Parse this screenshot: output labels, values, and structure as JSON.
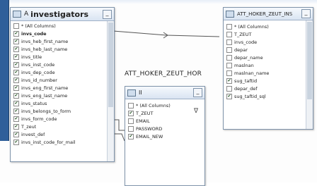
{
  "colors": {
    "accent": "#2f5f9a",
    "border": "#7f93aa",
    "title_bg": "#d9e4f2"
  },
  "tables": {
    "investigators": {
      "title_prefix": "A",
      "title": "investigators",
      "icon": "table-icon",
      "minimize": "_",
      "columns": [
        {
          "label": "* (All Columns)",
          "checked": false,
          "bold": false
        },
        {
          "label": "invs_code",
          "checked": true,
          "bold": true
        },
        {
          "label": "invs_heb_first_name",
          "checked": true,
          "bold": false
        },
        {
          "label": "invs_heb_last_name",
          "checked": true,
          "bold": false
        },
        {
          "label": "invs_title",
          "checked": true,
          "bold": false
        },
        {
          "label": "invs_inst_code",
          "checked": true,
          "bold": false
        },
        {
          "label": "invs_dep_code",
          "checked": true,
          "bold": false
        },
        {
          "label": "invs_id_number",
          "checked": true,
          "bold": false
        },
        {
          "label": "invs_eng_first_name",
          "checked": true,
          "bold": false
        },
        {
          "label": "invs_eng_last_name",
          "checked": true,
          "bold": false
        },
        {
          "label": "invs_status",
          "checked": true,
          "bold": false
        },
        {
          "label": "invs_belongs_to_form",
          "checked": true,
          "bold": false
        },
        {
          "label": "invs_form_code",
          "checked": true,
          "bold": false
        },
        {
          "label": "T_zeut",
          "checked": true,
          "bold": false
        },
        {
          "label": "invest_def",
          "checked": true,
          "bold": false
        },
        {
          "label": "invs_inst_code_for_mail",
          "checked": true,
          "bold": false
        }
      ]
    },
    "att_hoker_ins": {
      "title": "ATT_HOKER_ZEUT_INS",
      "icon": "table-icon",
      "minimize": "_",
      "columns": [
        {
          "label": "* (All Columns)",
          "checked": false
        },
        {
          "label": "T_ZEUT",
          "checked": false
        },
        {
          "label": "invs_code",
          "checked": false
        },
        {
          "label": "depar",
          "checked": false
        },
        {
          "label": "depar_name",
          "checked": false
        },
        {
          "label": "maslnan",
          "checked": false
        },
        {
          "label": "maslnan_name",
          "checked": false
        },
        {
          "label": "sug_taftid",
          "checked": true
        },
        {
          "label": "depar_def",
          "checked": false
        },
        {
          "label": "sug_taftid_sql",
          "checked": true
        }
      ]
    },
    "att_hoker_hor": {
      "caption": "ATT_HOKER_ZEUT_HOR",
      "title": "II",
      "icon": "table-icon",
      "minimize": "_",
      "filter_icon": "filter-icon",
      "filter_glyph": "∇",
      "columns": [
        {
          "label": "* (All Columns)",
          "checked": false
        },
        {
          "label": "T_ZEUT",
          "checked": true
        },
        {
          "label": "EMAIL",
          "checked": false
        },
        {
          "label": "PASSWORD",
          "checked": false
        },
        {
          "label": "EMAIL_NEW",
          "checked": true
        }
      ]
    }
  }
}
